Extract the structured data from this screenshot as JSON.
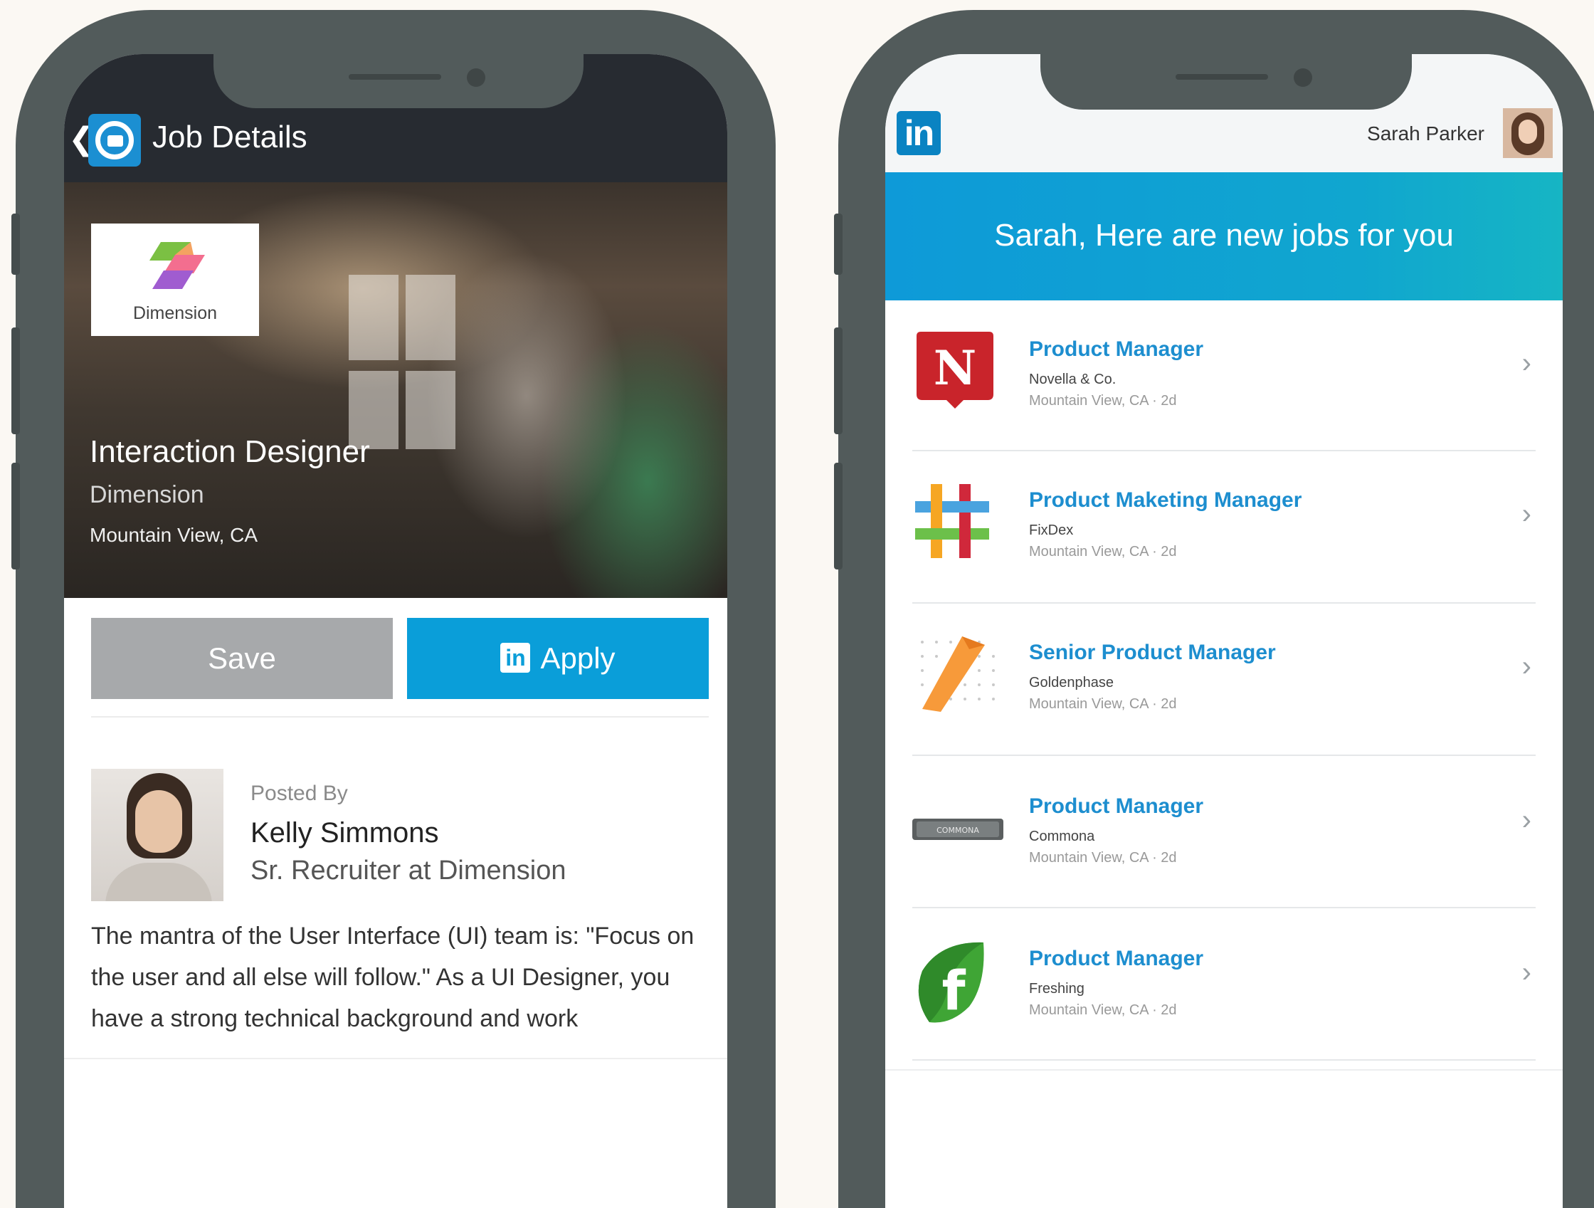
{
  "left_phone": {
    "header": {
      "back_icon": "chevron-left-icon",
      "app_icon": "job-search-icon",
      "title": "Job Details"
    },
    "hero": {
      "company_logo_text": "Dimension",
      "job_title": "Interaction Designer",
      "company": "Dimension",
      "location": "Mountain View, CA"
    },
    "actions": {
      "save_label": "Save",
      "apply_badge": "in",
      "apply_label": "Apply"
    },
    "poster": {
      "posted_by_label": "Posted By",
      "name": "Kelly Simmons",
      "role": "Sr. Recruiter at Dimension"
    },
    "description": "The mantra of the User Interface (UI) team is: \"Focus on the user and all else will follow.\" As a UI Designer, you have a strong technical background and work"
  },
  "right_phone": {
    "topbar": {
      "logo": "in",
      "user_name": "Sarah Parker"
    },
    "banner": "Sarah, Here are new jobs for you",
    "jobs": [
      {
        "title": "Product Manager",
        "company": "Novella & Co.",
        "location": "Mountain View, CA · 2d",
        "logo": "novella-logo"
      },
      {
        "title": "Product Maketing Manager",
        "company": "FixDex",
        "location": "Mountain View, CA · 2d",
        "logo": "fixdex-logo"
      },
      {
        "title": "Senior Product Manager",
        "company": "Goldenphase",
        "location": "Mountain View, CA · 2d",
        "logo": "goldenphase-logo"
      },
      {
        "title": "Product Manager",
        "company": "Commona",
        "location": "Mountain View, CA · 2d",
        "logo": "commona-logo",
        "logo_text": "COMMONA"
      },
      {
        "title": "Product Manager",
        "company": "Freshing",
        "location": "Mountain View, CA · 2d",
        "logo": "freshing-logo"
      }
    ],
    "chevron": "›"
  },
  "colors": {
    "linkedin_blue": "#0a9ed9",
    "frame": "#525b5b",
    "header_dark": "#272b31"
  }
}
